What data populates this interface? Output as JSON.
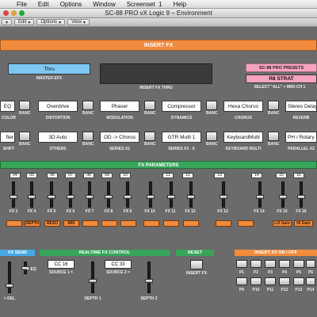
{
  "menubar": {
    "items": [
      "File",
      "Edit",
      "Options",
      "Window",
      "Screenset  1",
      "Help"
    ]
  },
  "window": {
    "title": "SC-88 PRO vX Logic 9 – Environment"
  },
  "toolbar": {
    "edit": "Edit",
    "options": "Options",
    "view": "View"
  },
  "insert_fx": {
    "title": "INSERT  FX",
    "master_efx_value": "Thru",
    "master_efx_label": "MASTER  EFX",
    "thru_label": "INSERT FX THRU",
    "presets_title": "SC-88 PRO  PRESETS",
    "presets_value": "R8 STRAT",
    "presets_label": "SELECT \"ALL\" + MIDI CH 1",
    "row1": [
      {
        "value": "EQ",
        "label": "COLOR"
      },
      {
        "value": "Overdrive",
        "label": "DISTORTION"
      },
      {
        "value": "Phaser",
        "label": "MODULATION"
      },
      {
        "value": "Compressor",
        "label": "DYNAMICS"
      },
      {
        "value": "Hexa Chorus",
        "label": "CHORUS"
      },
      {
        "value": "Stereo Delay",
        "label": "REVERB"
      }
    ],
    "row2": [
      {
        "value": "fter",
        "label": "SHIFT"
      },
      {
        "value": "3D Auto",
        "label": "OTHERS"
      },
      {
        "value": "OD -> Chorus",
        "label": "SERIES X2"
      },
      {
        "value": "GTR Multi 1",
        "label": "SERIES X3 - X"
      },
      {
        "value": "KeyboardMulti",
        "label": "KEYBOARD MULTI"
      },
      {
        "value": "PH / Rotary",
        "label": "PARALLEL X2"
      }
    ],
    "banc": "BANC"
  },
  "fx_params": {
    "title": "FX  PARAMETERS",
    "numbers": [
      "04",
      "05",
      "06",
      "07",
      "08",
      "09",
      "10",
      "11",
      "12",
      "13",
      "14",
      "15",
      "16"
    ],
    "labels": [
      "FX 3",
      "FX 4",
      "FX 5",
      "FX 6",
      "FX 7",
      "FX 8",
      "FX 9",
      "FX 10",
      "FX 11",
      "FX 12",
      "FX 13",
      "FX 14",
      "FX 15",
      "FX 16"
    ],
    "tags": [
      "",
      "DEPTH",
      "RESO",
      "MIX",
      "",
      "",
      "",
      "",
      "",
      "",
      "",
      "",
      "LO Gain",
      "Hi Gain"
    ]
  },
  "sections": {
    "fx_send": "FX  SEND",
    "realtime": "REALTIME  FX  CONTROL",
    "reset": "RESET",
    "insert_onoff": "INSERT FX  ON / OFF",
    "source1_value": "CC 16",
    "source1_label": "SOURCE 1 =",
    "source2_value": "CC 33",
    "source2_label": "SOURCE 2 =",
    "depth1": "DEPTH 1",
    "depth2": "DEPTH 2",
    "eq_label": "> EQ",
    "del_label": "> DEL",
    "insert_fx_label": "INSERT FX",
    "pads": [
      "P1",
      "P2",
      "P3",
      "P4",
      "P5",
      "P6",
      "P9",
      "P10",
      "P11",
      "P12",
      "P13",
      "P14"
    ]
  },
  "colors": {
    "orange": "#f28b3c",
    "blue": "#46a9e8",
    "green": "#37a55a",
    "pink": "#f7a3c0"
  }
}
